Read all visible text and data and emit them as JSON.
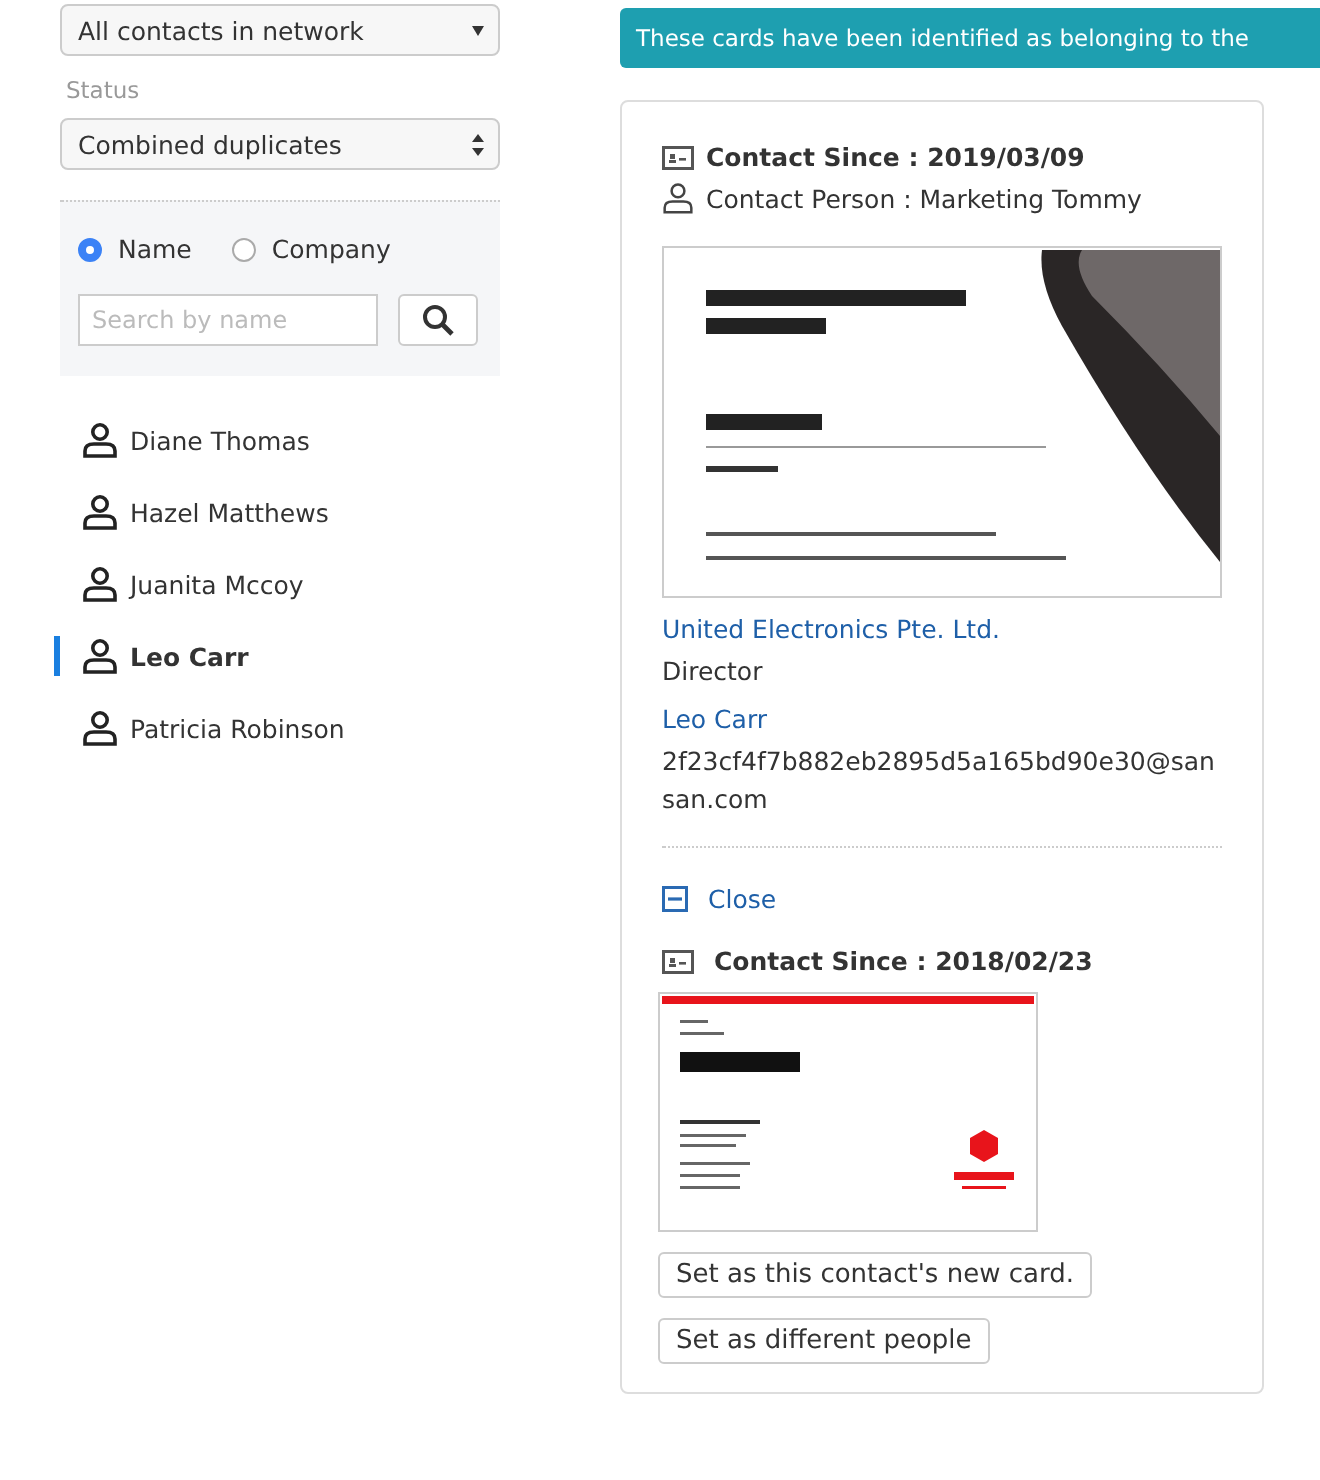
{
  "filters": {
    "scope_select": {
      "value": "All contacts in network"
    },
    "status_label": "Status",
    "status_select": {
      "value": "Combined duplicates"
    }
  },
  "search": {
    "options": [
      {
        "label": "Name",
        "selected": true
      },
      {
        "label": "Company",
        "selected": false
      }
    ],
    "placeholder": "Search by name"
  },
  "contacts": [
    {
      "name": "Diane Thomas",
      "selected": false
    },
    {
      "name": "Hazel Matthews",
      "selected": false
    },
    {
      "name": "Juanita Mccoy",
      "selected": false
    },
    {
      "name": "Leo Carr",
      "selected": true
    },
    {
      "name": "Patricia Robinson",
      "selected": false
    }
  ],
  "banner": "These cards have been identified as belonging to the",
  "main_card": {
    "contact_since": "Contact Since : 2019/03/09",
    "contact_person": "Contact Person : Marketing Tommy",
    "company": "United Electronics Pte. Ltd.",
    "title": "Director",
    "name": "Leo Carr",
    "email": "2f23cf4f7b882eb2895d5a165bd90e30@sansan.com"
  },
  "duplicate": {
    "toggle_label": "Close",
    "expanded": true,
    "contact_since": "Contact Since : 2018/02/23",
    "buttons": [
      "Set as this contact's new card.",
      "Set as different people"
    ]
  }
}
